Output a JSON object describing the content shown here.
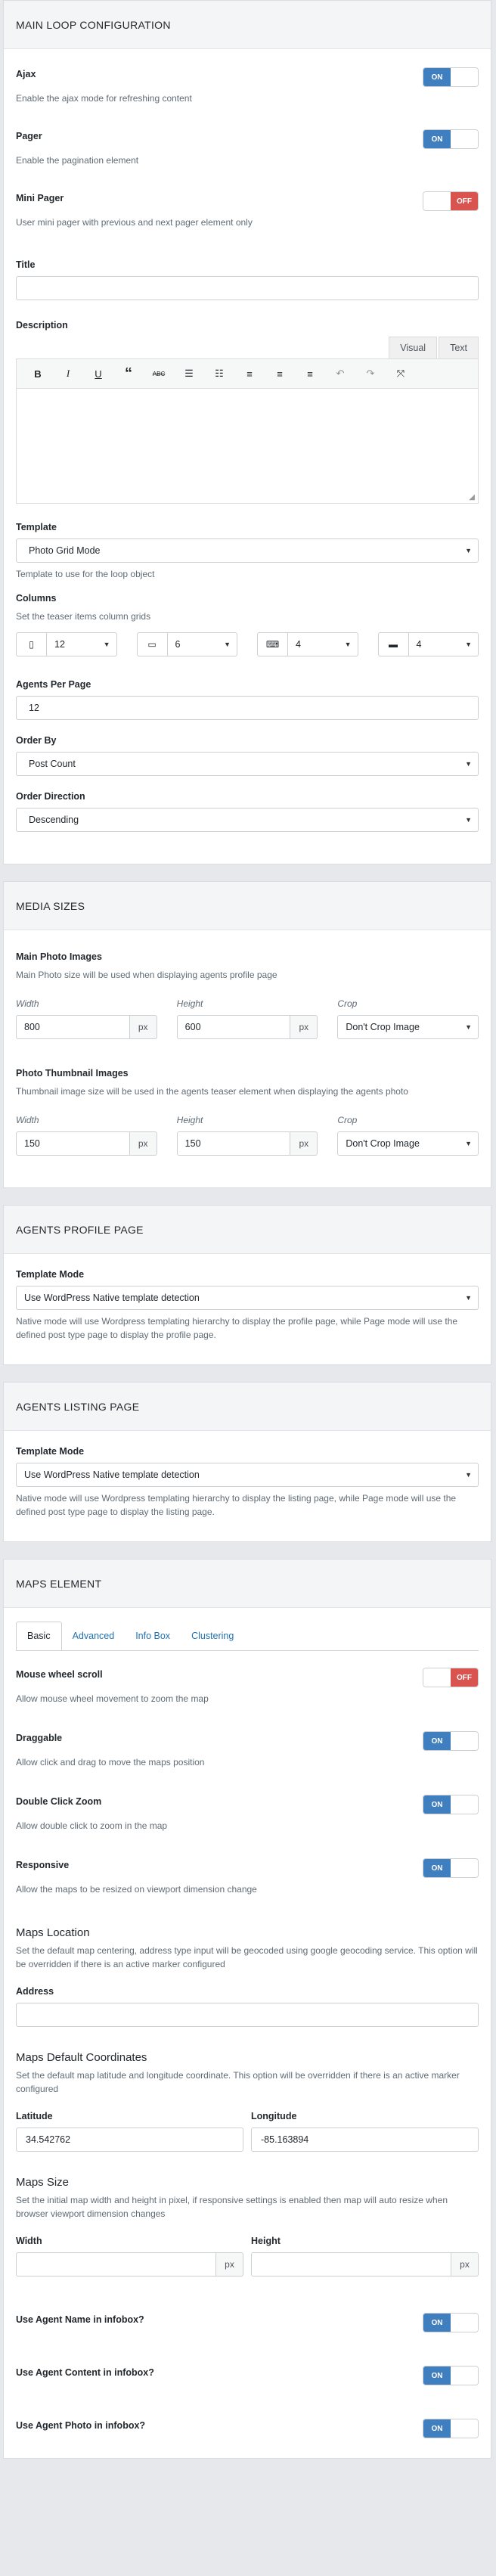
{
  "loop": {
    "title": "MAIN LOOP CONFIGURATION",
    "ajax": {
      "label": "Ajax",
      "help": "Enable the ajax mode for refreshing content",
      "state": "ON"
    },
    "pager": {
      "label": "Pager",
      "help": "Enable the pagination element",
      "state": "ON"
    },
    "mini_pager": {
      "label": "Mini Pager",
      "help": "User mini pager with previous and next pager element only",
      "state": "OFF"
    },
    "title_field": {
      "label": "Title",
      "value": ""
    },
    "description": {
      "label": "Description",
      "tab_visual": "Visual",
      "tab_text": "Text"
    },
    "template": {
      "label": "Template",
      "value": "Photo Grid Mode",
      "help": "Template to use for the loop object"
    },
    "columns": {
      "label": "Columns",
      "help": "Set the teaser items column grids",
      "values": [
        "12",
        "6",
        "4",
        "4"
      ]
    },
    "agents_per_page": {
      "label": "Agents Per Page",
      "value": "12"
    },
    "order_by": {
      "label": "Order By",
      "value": "Post Count"
    },
    "order_direction": {
      "label": "Order Direction",
      "value": "Descending"
    }
  },
  "media": {
    "title": "MEDIA SIZES",
    "main": {
      "label": "Main Photo Images",
      "help": "Main Photo size will be used when displaying agents profile page",
      "width_label": "Width",
      "width": "800",
      "height_label": "Height",
      "height": "600",
      "crop_label": "Crop",
      "crop": "Don't Crop Image"
    },
    "thumb": {
      "label": "Photo Thumbnail Images",
      "help": "Thumbnail image size will be used in the agents teaser element when displaying the agents photo",
      "width_label": "Width",
      "width": "150",
      "height_label": "Height",
      "height": "150",
      "crop_label": "Crop",
      "crop": "Don't Crop Image"
    },
    "unit": "px"
  },
  "profile": {
    "title": "AGENTS PROFILE PAGE",
    "label": "Template Mode",
    "value": "Use WordPress Native template detection",
    "help": "Native mode will use Wordpress templating hierarchy to display the profile page, while Page mode will use the defined post type page to display the profile page."
  },
  "listing": {
    "title": "AGENTS LISTING PAGE",
    "label": "Template Mode",
    "value": "Use WordPress Native template detection",
    "help": "Native mode will use Wordpress templating hierarchy to display the listing page, while Page mode will use the defined post type page to display the listing page."
  },
  "maps": {
    "title": "MAPS ELEMENT",
    "tabs": [
      "Basic",
      "Advanced",
      "Info Box",
      "Clustering"
    ],
    "mouse_wheel": {
      "label": "Mouse wheel scroll",
      "help": "Allow mouse wheel movement to zoom the map",
      "state": "OFF"
    },
    "draggable": {
      "label": "Draggable",
      "help": "Allow click and drag to move the maps position",
      "state": "ON"
    },
    "double_click": {
      "label": "Double Click Zoom",
      "help": "Allow double click to zoom in the map",
      "state": "ON"
    },
    "responsive": {
      "label": "Responsive",
      "help": "Allow the maps to be resized on viewport dimension change",
      "state": "ON"
    },
    "location": {
      "heading": "Maps Location",
      "help": "Set the default map centering, address type input will be geocoded using google geocoding service. This option will be overridden if there is an active marker configured",
      "address_label": "Address",
      "address": ""
    },
    "coords": {
      "heading": "Maps Default Coordinates",
      "help": "Set the default map latitude and longitude coordinate. This option will be overridden if there is an active marker configured",
      "lat_label": "Latitude",
      "lat": "34.542762",
      "lng_label": "Longitude",
      "lng": "-85.163894"
    },
    "size": {
      "heading": "Maps Size",
      "help": "Set the initial map width and height in pixel, if responsive settings is enabled then map will auto resize when browser viewport dimension changes",
      "width_label": "Width",
      "height_label": "Height",
      "unit": "px"
    },
    "agent_name": {
      "label": "Use Agent Name in infobox?",
      "state": "ON"
    },
    "agent_content": {
      "label": "Use Agent Content in infobox?",
      "state": "ON"
    },
    "agent_photo": {
      "label": "Use Agent Photo in infobox?",
      "state": "ON"
    }
  }
}
